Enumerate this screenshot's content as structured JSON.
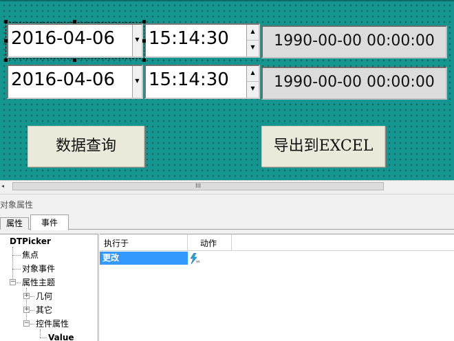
{
  "form": {
    "row1": {
      "date": "2016-04-06",
      "time": "15:14:30",
      "display": "1990-00-00 00:00:00"
    },
    "row2": {
      "date": "2016-04-06",
      "time": "15:14:30",
      "display": "1990-00-00 00:00:00"
    },
    "query_button": "数据查询",
    "export_button": "导出到EXCEL"
  },
  "scrollbar": {
    "thumb_grip": "III",
    "left_arrow": "◂"
  },
  "panel": {
    "title": "对象属性",
    "tabs": [
      {
        "label": "属性",
        "active": false
      },
      {
        "label": "事件",
        "active": true
      }
    ],
    "tree": {
      "root": "DTPicker",
      "items": [
        {
          "label": "焦点",
          "level": 1
        },
        {
          "label": "对象事件",
          "level": 1
        },
        {
          "label": "属性主题",
          "level": 1,
          "expanded": true
        },
        {
          "label": "几何",
          "level": 2,
          "expanded": false
        },
        {
          "label": "其它",
          "level": 2,
          "expanded": false
        },
        {
          "label": "控件属性",
          "level": 2,
          "expanded": true
        },
        {
          "label": "Value",
          "level": 3
        }
      ]
    },
    "grid": {
      "columns": [
        "执行于",
        "动作"
      ],
      "rows": [
        {
          "event": "更改",
          "action_icon": "vbscript-lightning-icon"
        }
      ]
    }
  },
  "colors": {
    "canvas": "#15958f",
    "selection": "#3399ff",
    "button_face": "#ebe9da"
  }
}
